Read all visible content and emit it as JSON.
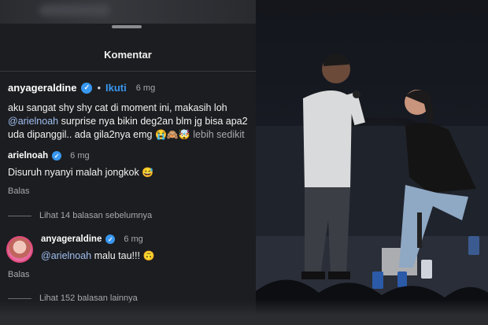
{
  "header": {
    "title": "Komentar"
  },
  "post": {
    "username": "anyageraldine",
    "follow_label": "Ikuti",
    "time": "6 mg",
    "caption_line1": "aku sangat shy shy cat di moment ini, makasih loh",
    "mention": "@arielnoah",
    "caption_line2_rest": " surprise nya bikin deg2an blm jg bisa apa2",
    "caption_line3": "uda dipanggil.. ada gila2nya emg",
    "caption_emojis": "😭🙈🤯",
    "more_label": "lebih sedikit"
  },
  "reply1": {
    "username": "arielnoah",
    "time": "6 mg",
    "text": "Disuruh nyanyi malah jongkok",
    "emoji": "😅",
    "reply_label": "Balas"
  },
  "view_previous": "Lihat 14 balasan sebelumnya",
  "reply2": {
    "username": "anyageraldine",
    "time": "6 mg",
    "mention": "@arielnoah",
    "text": " malu tau!!!",
    "emoji": "🙃",
    "reply_label": "Balas"
  },
  "view_more": "Lihat 152 balasan lainnya",
  "colors": {
    "accent": "#3897f0",
    "background": "#1c1d20"
  }
}
